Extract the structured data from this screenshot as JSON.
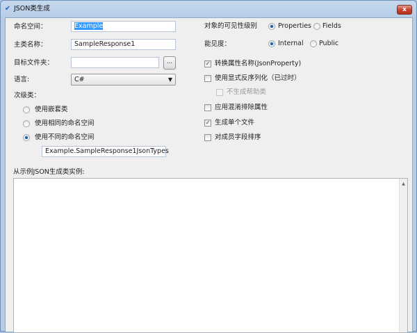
{
  "window": {
    "title": "JSON类生成",
    "close_label": "x"
  },
  "left": {
    "namespace": {
      "label": "命名空间：",
      "value": "Example"
    },
    "main_class": {
      "label": "主类名称：",
      "value": "SampleResponse1"
    },
    "target_folder": {
      "label": "目标文件夹：",
      "value": "",
      "browse_label": "..."
    },
    "language": {
      "label": "语言:",
      "value": "C#"
    },
    "subclass": {
      "label": "次级类：",
      "options": [
        {
          "label": "使用嵌套类",
          "selected": false
        },
        {
          "label": "使用相同的命名空间",
          "selected": false
        },
        {
          "label": "使用不同的命名空间",
          "selected": true
        }
      ],
      "namespace_value": "Example.SampleResponse1JsonTypes"
    }
  },
  "right": {
    "object_visibility": {
      "label": "对象的可见性级别",
      "options": [
        {
          "label": "Properties",
          "selected": true
        },
        {
          "label": "Fields",
          "selected": false
        }
      ]
    },
    "visibility": {
      "label": "能见度：",
      "options": [
        {
          "label": "Internal",
          "selected": true
        },
        {
          "label": "Public",
          "selected": false
        }
      ]
    },
    "checkboxes": [
      {
        "label": "转换属性名称(JsonProperty)",
        "checked": true
      },
      {
        "label": "使用显式反序列化（已过时）",
        "checked": false
      },
      {
        "label": "不生成帮助类",
        "checked": false,
        "disabled": true
      },
      {
        "label": "应用混淆排除属性",
        "checked": false
      },
      {
        "label": "生成单个文件",
        "checked": true
      },
      {
        "label": "对成员字段排序",
        "checked": false
      }
    ]
  },
  "sample": {
    "label": "从示例JSON生成类实例:",
    "value": ""
  }
}
